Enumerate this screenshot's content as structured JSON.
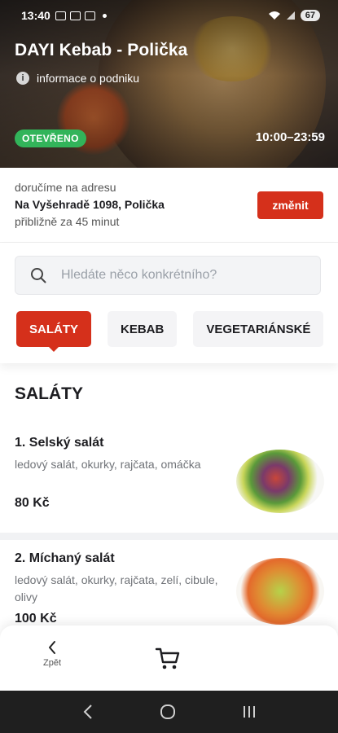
{
  "status": {
    "time": "13:40",
    "battery": "67"
  },
  "restaurant": {
    "name": "DAYI Kebab - Polička",
    "info_link": "informace o podniku",
    "status_badge": "OTEVŘENO",
    "hours": "10:00–23:59"
  },
  "delivery": {
    "label": "doručíme na adresu",
    "address": "Na Vyšehradě 1098, Polička",
    "eta": "přibližně za 45 minut",
    "change_label": "změnit"
  },
  "search": {
    "placeholder": "Hledáte něco konkrétního?"
  },
  "tabs": [
    {
      "label": "SALÁTY",
      "active": true
    },
    {
      "label": "KEBAB",
      "active": false
    },
    {
      "label": "VEGETARIÁNSKÉ",
      "active": false
    }
  ],
  "section": {
    "title": "SALÁTY"
  },
  "items": [
    {
      "name": "1. Selský salát",
      "desc": "ledový salát, okurky, rajčata, omáčka",
      "price": "80 Kč"
    },
    {
      "name": "2. Míchaný salát",
      "desc": "ledový salát, okurky, rajčata, zelí, cibule, olivy",
      "price": "100 Kč"
    }
  ],
  "bottom_nav": {
    "back_label": "Zpět"
  },
  "colors": {
    "accent": "#d5301b",
    "open": "#32b45a"
  }
}
